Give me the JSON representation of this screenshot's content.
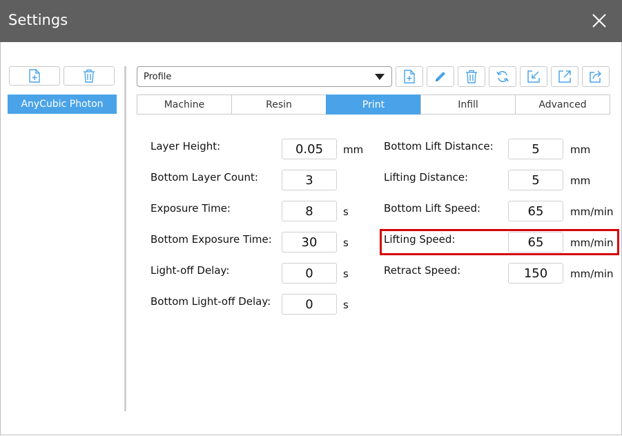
{
  "window": {
    "title": "Settings"
  },
  "sidebar": {
    "profiles": [
      "AnyCubic Photon"
    ]
  },
  "profile_select": {
    "value": "Profile"
  },
  "tabs": [
    "Machine",
    "Resin",
    "Print",
    "Infill",
    "Advanced"
  ],
  "active_tab": "Print",
  "print": {
    "left": [
      {
        "label": "Layer Height:",
        "value": "0.05",
        "unit": "mm"
      },
      {
        "label": "Bottom Layer Count:",
        "value": "3",
        "unit": ""
      },
      {
        "label": "Exposure Time:",
        "value": "8",
        "unit": "s"
      },
      {
        "label": "Bottom Exposure Time:",
        "value": "30",
        "unit": "s"
      },
      {
        "label": "Light-off Delay:",
        "value": "0",
        "unit": "s"
      },
      {
        "label": "Bottom Light-off Delay:",
        "value": "0",
        "unit": "s"
      }
    ],
    "right": [
      {
        "label": "Bottom Lift Distance:",
        "value": "5",
        "unit": "mm"
      },
      {
        "label": "Lifting Distance:",
        "value": "5",
        "unit": "mm"
      },
      {
        "label": "Bottom Lift Speed:",
        "value": "65",
        "unit": "mm/min"
      },
      {
        "label": "Lifting Speed:",
        "value": "65",
        "unit": "mm/min"
      },
      {
        "label": "Retract Speed:",
        "value": "150",
        "unit": "mm/min"
      }
    ]
  },
  "colors": {
    "accent": "#4aa3e8",
    "titlebar": "#5f5f5f",
    "highlight": "#d40000"
  },
  "icons": [
    "add-file-icon",
    "trash-icon",
    "edit-pencil-icon",
    "refresh-icon",
    "import-icon",
    "export-icon",
    "share-icon",
    "close-icon"
  ]
}
